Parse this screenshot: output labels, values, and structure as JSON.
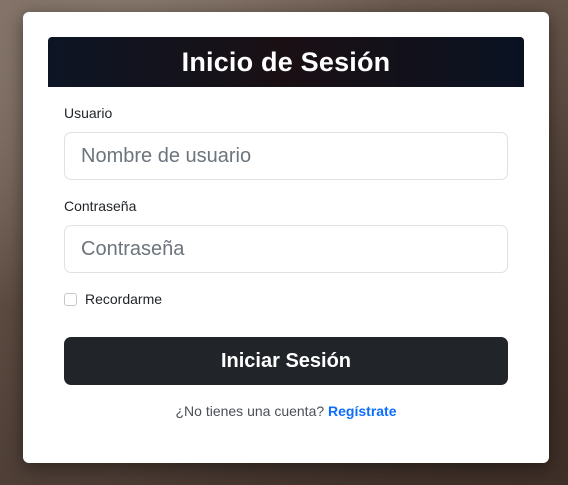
{
  "login": {
    "title": "Inicio de Sesión",
    "username_label": "Usuario",
    "username_placeholder": "Nombre de usuario",
    "username_value": "",
    "password_label": "Contraseña",
    "password_placeholder": "Contraseña",
    "password_value": "",
    "remember_label": "Recordarme",
    "remember_checked": false,
    "submit_label": "Iniciar Sesión",
    "register_prompt": "¿No tienes una cuenta?",
    "register_link": "Regístrate"
  },
  "colors": {
    "header_bg": "#0d1524",
    "button_bg": "#212529",
    "link": "#0d6efd"
  }
}
